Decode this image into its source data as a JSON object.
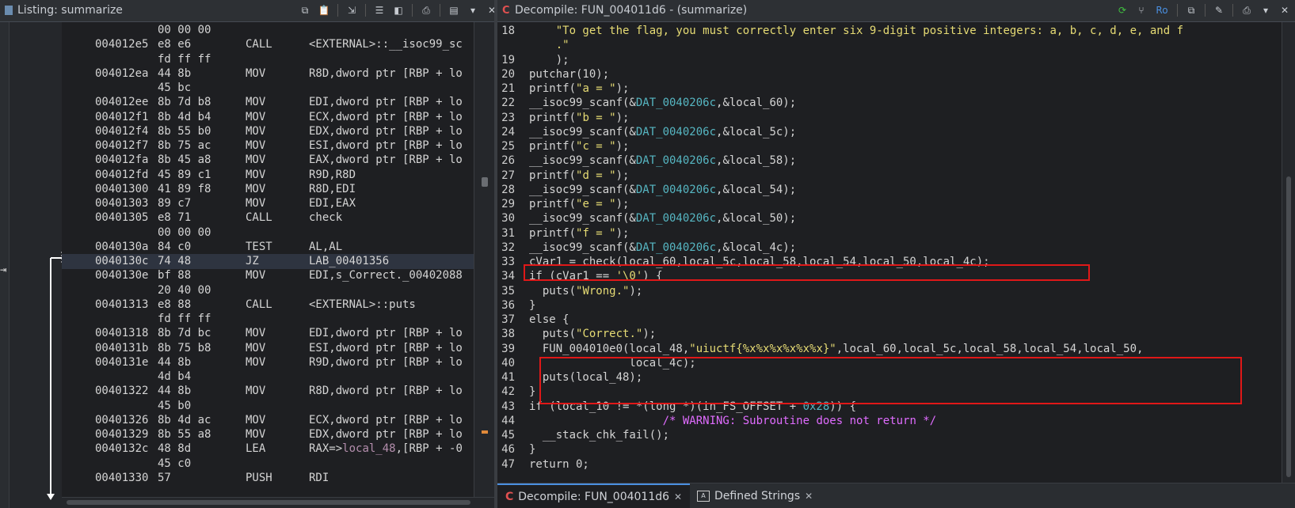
{
  "listing_panel": {
    "title": "Listing:  summarize",
    "rows": [
      {
        "addr": "",
        "bytes": "00 00 00",
        "mnem": "",
        "ops": ""
      },
      {
        "addr": "004012e5",
        "bytes": "e8 e6",
        "mnem": "CALL",
        "ops": "<EXTERNAL>::__isoc99_sc"
      },
      {
        "addr": "",
        "bytes": "fd ff ff",
        "mnem": "",
        "ops": ""
      },
      {
        "addr": "004012ea",
        "bytes": "44 8b",
        "mnem": "MOV",
        "ops": "R8D,dword ptr [RBP + lo"
      },
      {
        "addr": "",
        "bytes": "45 bc",
        "mnem": "",
        "ops": ""
      },
      {
        "addr": "004012ee",
        "bytes": "8b 7d b8",
        "mnem": "MOV",
        "ops": "EDI,dword ptr [RBP + lo"
      },
      {
        "addr": "004012f1",
        "bytes": "8b 4d b4",
        "mnem": "MOV",
        "ops": "ECX,dword ptr [RBP + lo"
      },
      {
        "addr": "004012f4",
        "bytes": "8b 55 b0",
        "mnem": "MOV",
        "ops": "EDX,dword ptr [RBP + lo"
      },
      {
        "addr": "004012f7",
        "bytes": "8b 75 ac",
        "mnem": "MOV",
        "ops": "ESI,dword ptr [RBP + lo"
      },
      {
        "addr": "004012fa",
        "bytes": "8b 45 a8",
        "mnem": "MOV",
        "ops": "EAX,dword ptr [RBP + lo"
      },
      {
        "addr": "004012fd",
        "bytes": "45 89 c1",
        "mnem": "MOV",
        "ops": "R9D,R8D"
      },
      {
        "addr": "00401300",
        "bytes": "41 89 f8",
        "mnem": "MOV",
        "ops": "R8D,EDI"
      },
      {
        "addr": "00401303",
        "bytes": "89 c7",
        "mnem": "MOV",
        "ops": "EDI,EAX"
      },
      {
        "addr": "00401305",
        "bytes": "e8 71",
        "mnem": "CALL",
        "ops": "check"
      },
      {
        "addr": "",
        "bytes": "00 00 00",
        "mnem": "",
        "ops": ""
      },
      {
        "addr": "0040130a",
        "bytes": "84 c0",
        "mnem": "TEST",
        "ops": "AL,AL"
      },
      {
        "addr": "0040130c",
        "bytes": "74 48",
        "mnem": "JZ",
        "ops": "LAB_00401356"
      },
      {
        "addr": "0040130e",
        "bytes": "bf 88",
        "mnem": "MOV",
        "ops": "EDI,s_Correct._00402088"
      },
      {
        "addr": "",
        "bytes": "20 40 00",
        "mnem": "",
        "ops": ""
      },
      {
        "addr": "00401313",
        "bytes": "e8 88",
        "mnem": "CALL",
        "ops": "<EXTERNAL>::puts"
      },
      {
        "addr": "",
        "bytes": "fd ff ff",
        "mnem": "",
        "ops": ""
      },
      {
        "addr": "00401318",
        "bytes": "8b 7d bc",
        "mnem": "MOV",
        "ops": "EDI,dword ptr [RBP + lo"
      },
      {
        "addr": "0040131b",
        "bytes": "8b 75 b8",
        "mnem": "MOV",
        "ops": "ESI,dword ptr [RBP + lo"
      },
      {
        "addr": "0040131e",
        "bytes": "44 8b",
        "mnem": "MOV",
        "ops": "R9D,dword ptr [RBP + lo"
      },
      {
        "addr": "",
        "bytes": "4d b4",
        "mnem": "",
        "ops": ""
      },
      {
        "addr": "00401322",
        "bytes": "44 8b",
        "mnem": "MOV",
        "ops": "R8D,dword ptr [RBP + lo"
      },
      {
        "addr": "",
        "bytes": "45 b0",
        "mnem": "",
        "ops": ""
      },
      {
        "addr": "00401326",
        "bytes": "8b 4d ac",
        "mnem": "MOV",
        "ops": "ECX,dword ptr [RBP + lo"
      },
      {
        "addr": "00401329",
        "bytes": "8b 55 a8",
        "mnem": "MOV",
        "ops": "EDX,dword ptr [RBP + lo"
      },
      {
        "addr": "0040132c",
        "bytes": "48 8d",
        "mnem": "LEA",
        "ops_pre": "RAX=>",
        "ops_var": "local_48",
        "ops_post": ",[RBP + -0"
      },
      {
        "addr": "",
        "bytes": "45 c0",
        "mnem": "",
        "ops": ""
      },
      {
        "addr": "00401330",
        "bytes": "57",
        "mnem": "PUSH",
        "ops": "RDI"
      }
    ]
  },
  "decompile_panel": {
    "title": "Decompile: FUN_004011d6 -  (summarize)",
    "toolbar_label": "Ro",
    "lines": [
      {
        "n": "18",
        "parts": [
          {
            "t": "    "
          },
          {
            "t": "\"To get the flag, you must correctly enter six 9-digit positive integers: a, b, c, d, e, and f",
            "c": "s"
          }
        ]
      },
      {
        "n": "",
        "parts": [
          {
            "t": "    "
          },
          {
            "t": ".\"",
            "c": "s"
          }
        ]
      },
      {
        "n": "19",
        "parts": [
          {
            "t": "    );"
          }
        ]
      },
      {
        "n": "20",
        "parts": [
          {
            "t": "putchar(10);"
          }
        ]
      },
      {
        "n": "21",
        "parts": [
          {
            "t": "printf("
          },
          {
            "t": "\"a = \"",
            "c": "s"
          },
          {
            "t": ");"
          }
        ]
      },
      {
        "n": "22",
        "parts": [
          {
            "t": "__isoc99_scanf(&"
          },
          {
            "t": "DAT_0040206c",
            "c": "g"
          },
          {
            "t": ",&local_60);"
          }
        ]
      },
      {
        "n": "23",
        "parts": [
          {
            "t": "printf("
          },
          {
            "t": "\"b = \"",
            "c": "s"
          },
          {
            "t": ");"
          }
        ]
      },
      {
        "n": "24",
        "parts": [
          {
            "t": "__isoc99_scanf(&"
          },
          {
            "t": "DAT_0040206c",
            "c": "g"
          },
          {
            "t": ",&local_5c);"
          }
        ]
      },
      {
        "n": "25",
        "parts": [
          {
            "t": "printf("
          },
          {
            "t": "\"c = \"",
            "c": "s"
          },
          {
            "t": ");"
          }
        ]
      },
      {
        "n": "26",
        "parts": [
          {
            "t": "__isoc99_scanf(&"
          },
          {
            "t": "DAT_0040206c",
            "c": "g"
          },
          {
            "t": ",&local_58);"
          }
        ]
      },
      {
        "n": "27",
        "parts": [
          {
            "t": "printf("
          },
          {
            "t": "\"d = \"",
            "c": "s"
          },
          {
            "t": ");"
          }
        ]
      },
      {
        "n": "28",
        "parts": [
          {
            "t": "__isoc99_scanf(&"
          },
          {
            "t": "DAT_0040206c",
            "c": "g"
          },
          {
            "t": ",&local_54);"
          }
        ]
      },
      {
        "n": "29",
        "parts": [
          {
            "t": "printf("
          },
          {
            "t": "\"e = \"",
            "c": "s"
          },
          {
            "t": ");"
          }
        ]
      },
      {
        "n": "30",
        "parts": [
          {
            "t": "__isoc99_scanf(&"
          },
          {
            "t": "DAT_0040206c",
            "c": "g"
          },
          {
            "t": ",&local_50);"
          }
        ]
      },
      {
        "n": "31",
        "parts": [
          {
            "t": "printf("
          },
          {
            "t": "\"f = \"",
            "c": "s"
          },
          {
            "t": ");"
          }
        ]
      },
      {
        "n": "32",
        "parts": [
          {
            "t": "__isoc99_scanf(&"
          },
          {
            "t": "DAT_0040206c",
            "c": "g"
          },
          {
            "t": ",&local_4c);"
          }
        ]
      },
      {
        "n": "33",
        "parts": [
          {
            "t": "cVar1 = check(local_60,local_5c,local_58,local_54,local_50,local_4c);"
          }
        ]
      },
      {
        "n": "34",
        "parts": [
          {
            "t": "if (cVar1 == "
          },
          {
            "t": "'\\0'",
            "c": "s"
          },
          {
            "t": ") {"
          }
        ]
      },
      {
        "n": "35",
        "parts": [
          {
            "t": "  puts("
          },
          {
            "t": "\"Wrong.\"",
            "c": "s"
          },
          {
            "t": ");"
          }
        ]
      },
      {
        "n": "36",
        "parts": [
          {
            "t": "}"
          }
        ]
      },
      {
        "n": "37",
        "parts": [
          {
            "t": "else {"
          }
        ]
      },
      {
        "n": "38",
        "parts": [
          {
            "t": "  puts("
          },
          {
            "t": "\"Correct.\"",
            "c": "s"
          },
          {
            "t": ");"
          }
        ]
      },
      {
        "n": "39",
        "parts": [
          {
            "t": "  FUN_004010e0(local_48,"
          },
          {
            "t": "\"uiuctf{%x%x%x%x%x%x}\"",
            "c": "s"
          },
          {
            "t": ",local_60,local_5c,local_58,local_54,local_50,"
          }
        ]
      },
      {
        "n": "40",
        "parts": [
          {
            "t": "               local_4c);"
          }
        ]
      },
      {
        "n": "41",
        "parts": [
          {
            "t": "  puts(local_48);"
          }
        ]
      },
      {
        "n": "42",
        "parts": [
          {
            "t": "}"
          }
        ]
      },
      {
        "n": "43",
        "parts": [
          {
            "t": "if (local_10 != *(long *)(in_FS_OFFSET + "
          },
          {
            "t": "0x28",
            "c": "n"
          },
          {
            "t": ")) {"
          }
        ]
      },
      {
        "n": "44",
        "parts": [
          {
            "t": "                    "
          },
          {
            "t": "/* WARNING: Subroutine does not return */",
            "c": "cm"
          }
        ]
      },
      {
        "n": "45",
        "parts": [
          {
            "t": "  __stack_chk_fail();"
          }
        ]
      },
      {
        "n": "46",
        "parts": [
          {
            "t": "}"
          }
        ]
      },
      {
        "n": "47",
        "parts": [
          {
            "t": "return 0;"
          }
        ]
      }
    ]
  },
  "tabs": [
    {
      "label": "Decompile: FUN_004011d6",
      "active": true
    },
    {
      "label": "Defined Strings",
      "active": false
    }
  ],
  "colors": {
    "highlight_box": "#e01818",
    "string": "#e6db74",
    "global": "#56b6c2",
    "comment": "#e06cff"
  }
}
